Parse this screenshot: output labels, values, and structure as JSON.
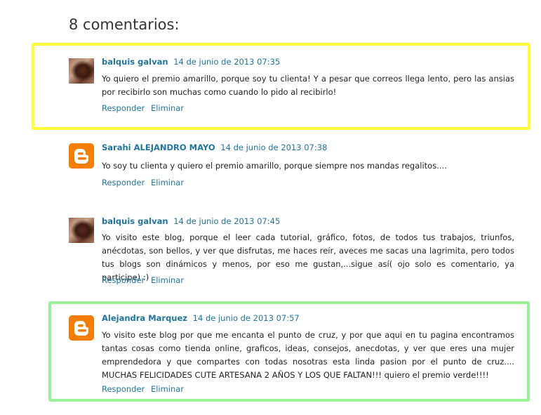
{
  "heading": "8 comentarios:",
  "comments": [
    {
      "author": "balquis galvan",
      "date": "14 de junio de 2013 07:35",
      "avatar": "photo-avatar",
      "text": "Yo quiero el premio amarillo, porque soy tu clienta! Y a pesar que correos llega lento, pero las ansias por recibirlo son muchas como cuando lo pido al recibirlo!",
      "reply": "Responder",
      "delete": "Eliminar",
      "highlight": "yellow"
    },
    {
      "author": "Sarahi ALEJANDRO MAYO",
      "date": "14 de junio de 2013 07:38",
      "avatar": "blogger-icon",
      "text": "Yo soy tu clienta y quiero el premio amarillo, porque siempre nos mandas regalitos....",
      "reply": "Responder",
      "delete": "Eliminar"
    },
    {
      "author": "balquis galvan",
      "date": "14 de junio de 2013 07:45",
      "avatar": "photo-avatar",
      "text": "Yo visito este blog, porque el leer cada tutorial, gráfico, fotos, de todos tus trabajos, triunfos, anécdotas, son bellos, y ver que disfrutas, me haces reír, aveces me sacas una lagrimita, pero todos tus blogs son dinámicos y menos, por eso me gustan,...sigue así( ojo solo es comentario, ya participe) :)",
      "reply": "Responder",
      "delete": "Eliminar"
    },
    {
      "author": "Alejandra Marquez",
      "date": "14 de junio de 2013 07:57",
      "avatar": "blogger-icon",
      "text": "Yo visito este blog por que me encanta el punto de cruz, y por que aqui en tu pagina encontramos tantas cosas como tienda online, graficos, ideas, consejos, anecdotas, y ver que eres una mujer emprendedora y que compartes con todas nosotras esta linda pasion por el punto de cruz.... MUCHAS FELICIDADES CUTE ARTESANA 2 AÑOS Y LOS QUE FALTAN!!! quiero el premio verde!!!!",
      "reply": "Responder",
      "delete": "Eliminar",
      "highlight": "green"
    }
  ],
  "colors": {
    "link": "#21759b",
    "yellow_highlight": "#ffff33",
    "green_highlight": "#99f099",
    "blogger_orange": "#f57d00"
  }
}
